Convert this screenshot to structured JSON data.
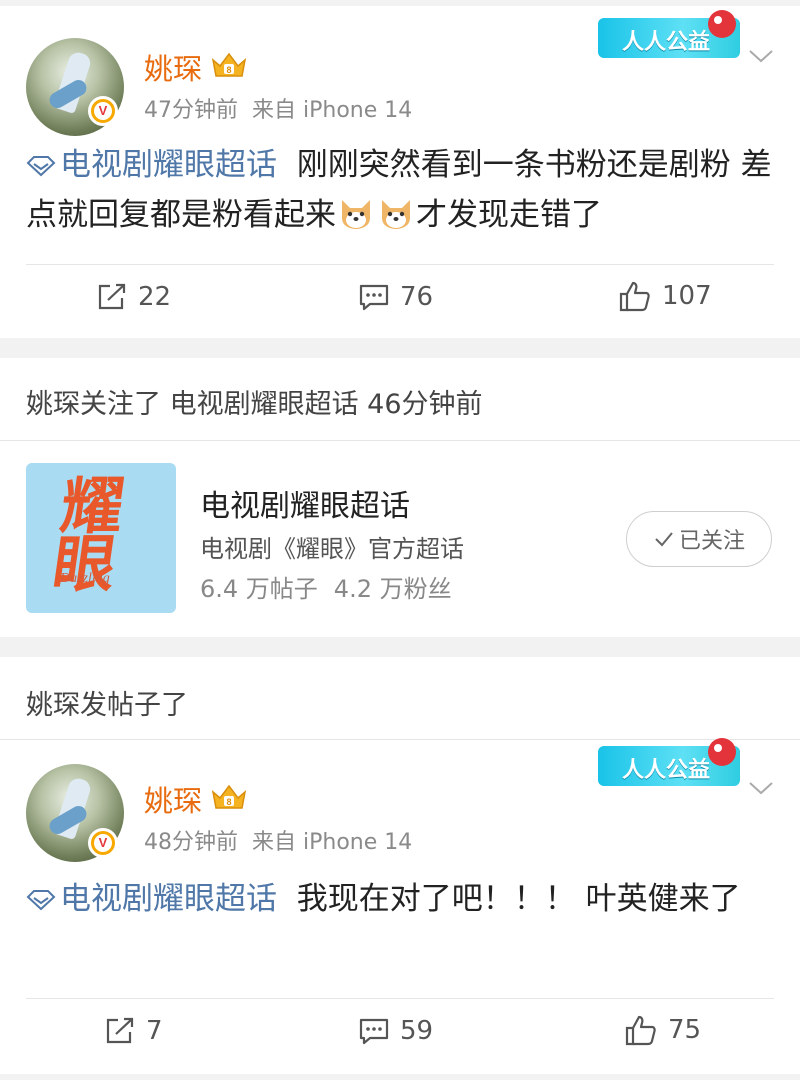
{
  "posts": [
    {
      "username": "姚琛",
      "time": "47分钟前",
      "source": "来自 iPhone 14",
      "banner": "人人公益",
      "topic": "电视剧耀眼超话",
      "text_a": "刚刚突然看到一条书粉还是剧粉 差点就回复都是粉看起来",
      "text_b": "才发现走错了",
      "reposts": "22",
      "comments": "76",
      "likes": "107"
    },
    {
      "username": "姚琛",
      "time": "48分钟前",
      "source": "来自 iPhone 14",
      "banner": "人人公益",
      "topic": "电视剧耀眼超话",
      "text_a": "我现在对了吧！！！ 叶英健来了",
      "reposts": "7",
      "comments": "59",
      "likes": "75"
    }
  ],
  "follow_notice": "姚琛关注了 电视剧耀眼超话 46分钟前",
  "supertopic_card": {
    "image_title": "耀眼",
    "image_sub": "Dazzling",
    "title": "电视剧耀眼超话",
    "subtitle": "电视剧《耀眼》官方超话",
    "posts": "6.4 万帖子",
    "fans": "4.2 万粉丝",
    "follow_label": "已关注"
  },
  "post_notice": "姚琛发帖子了",
  "colors": {
    "username": "#e86b0f",
    "topic": "#4f77a8",
    "background_gap": "#f2f2f2"
  },
  "icons": [
    "crown-badge-icon",
    "verified-v-icon",
    "chevron-down-icon",
    "supertopic-diamond-icon",
    "repost-icon",
    "comment-icon",
    "like-icon",
    "dog-emoji-icon",
    "check-icon"
  ]
}
